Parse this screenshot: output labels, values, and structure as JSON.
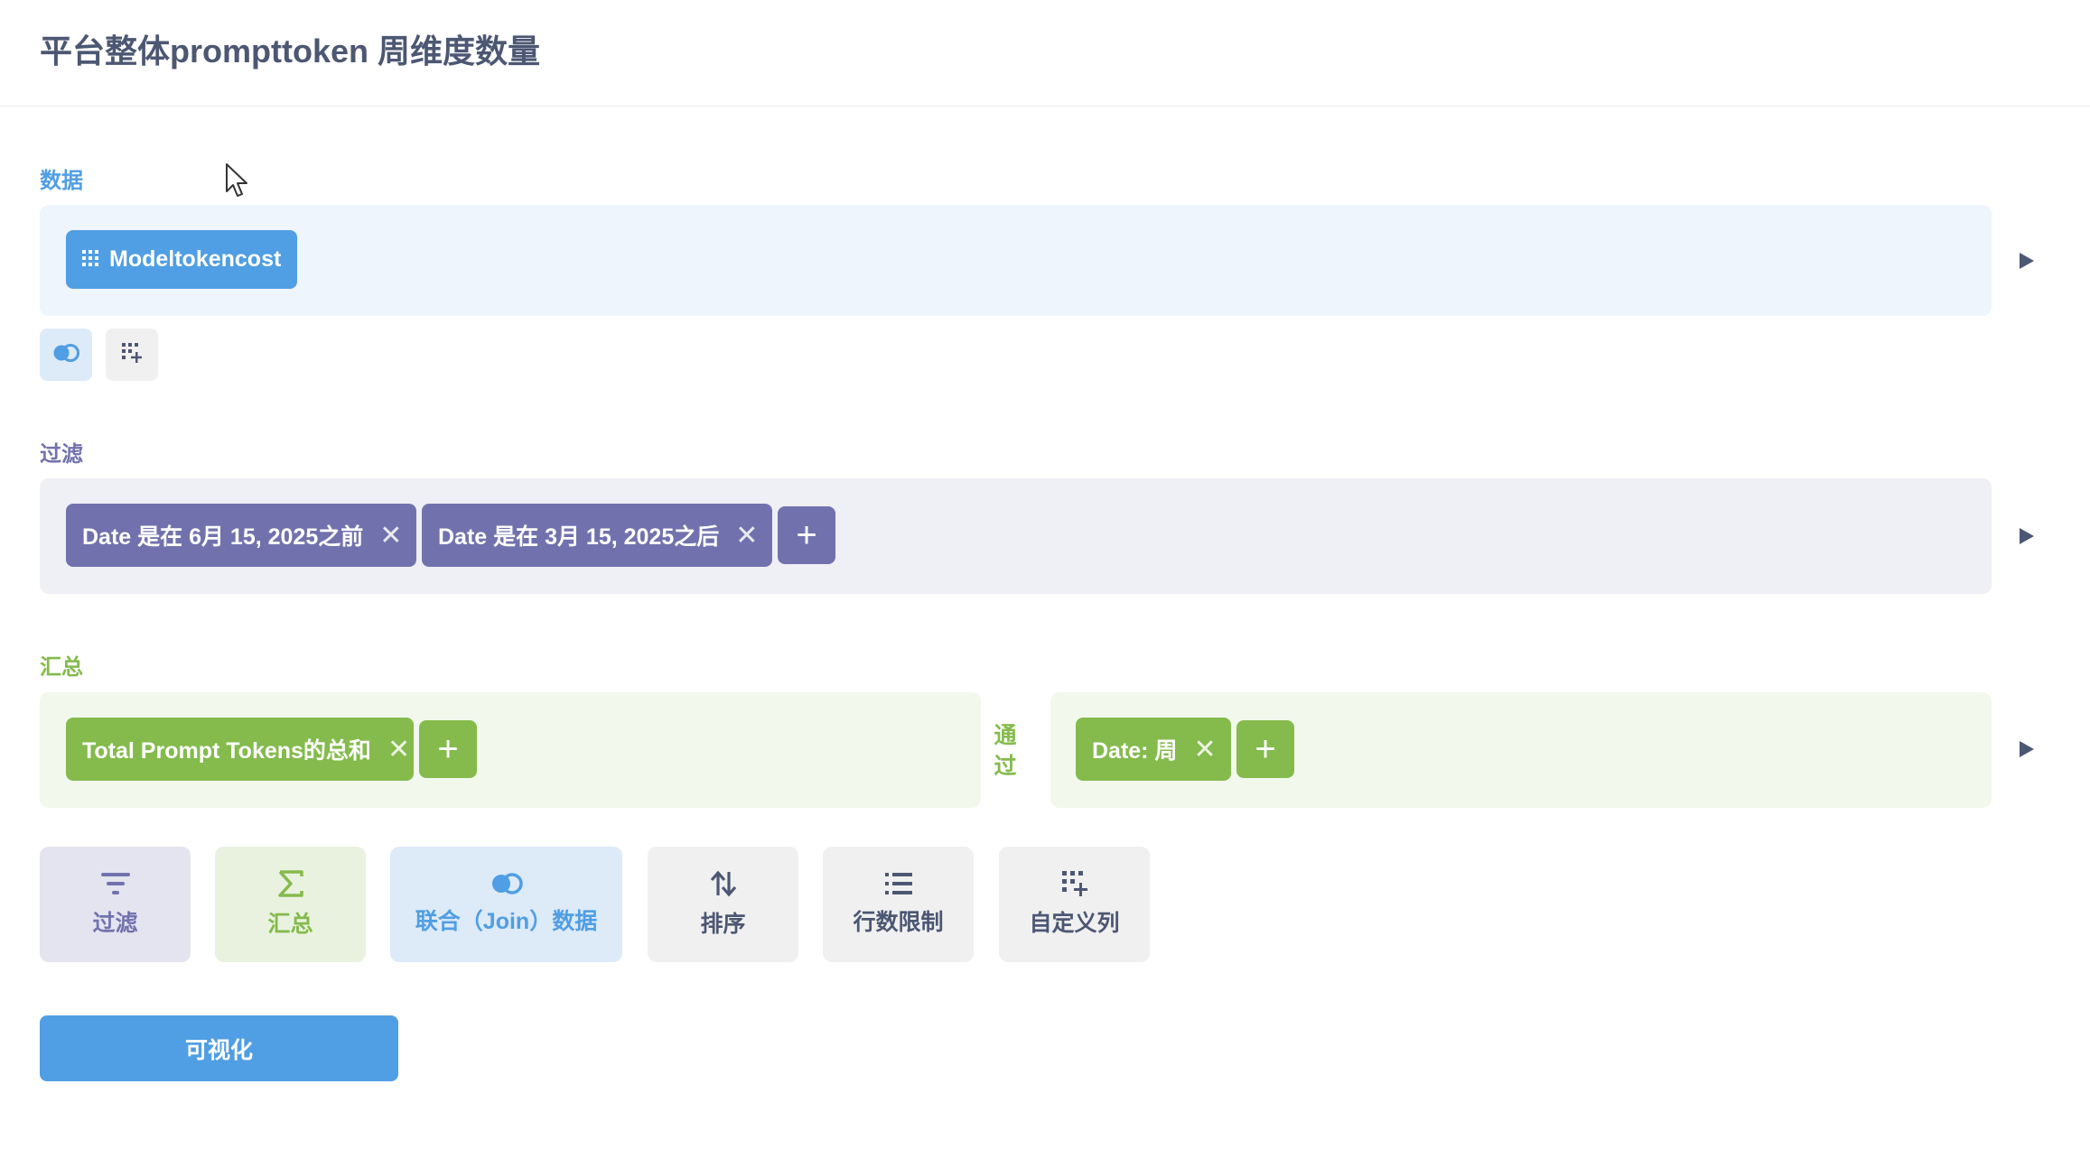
{
  "page": {
    "title": "平台整体prompttoken 周维度数量"
  },
  "data_section": {
    "label": "数据",
    "table_name": "Modeltokencost"
  },
  "filter_section": {
    "label": "过滤",
    "filters": [
      {
        "text": "Date 是在 6月 15, 2025之前"
      },
      {
        "text": "Date 是在 3月 15, 2025之后"
      }
    ],
    "add": "+"
  },
  "summarize_section": {
    "label": "汇总",
    "metrics": [
      {
        "text": "Total Prompt Tokens的总和"
      }
    ],
    "metric_add": "+",
    "by_label": "通过",
    "breakouts": [
      {
        "text": "Date: 周"
      }
    ],
    "breakout_add": "+"
  },
  "toolbar": {
    "filter": "过滤",
    "summarize": "汇总",
    "join": "联合（Join）数据",
    "sort": "排序",
    "limit": "行数限制",
    "custom_column": "自定义列"
  },
  "visualize_button": "可视化",
  "colors": {
    "data": "#509ee3",
    "filter": "#7172ad",
    "summarize": "#84bb4c",
    "text": "#4c5773"
  },
  "icons": {
    "table": "grid-icon",
    "join": "join-icon",
    "custom_column": "add-column-icon",
    "filter": "filter-icon",
    "summarize": "sigma-icon",
    "sort": "sort-icon",
    "limit": "list-icon",
    "close": "close-icon",
    "run": "play-icon",
    "cursor": "cursor-icon"
  }
}
